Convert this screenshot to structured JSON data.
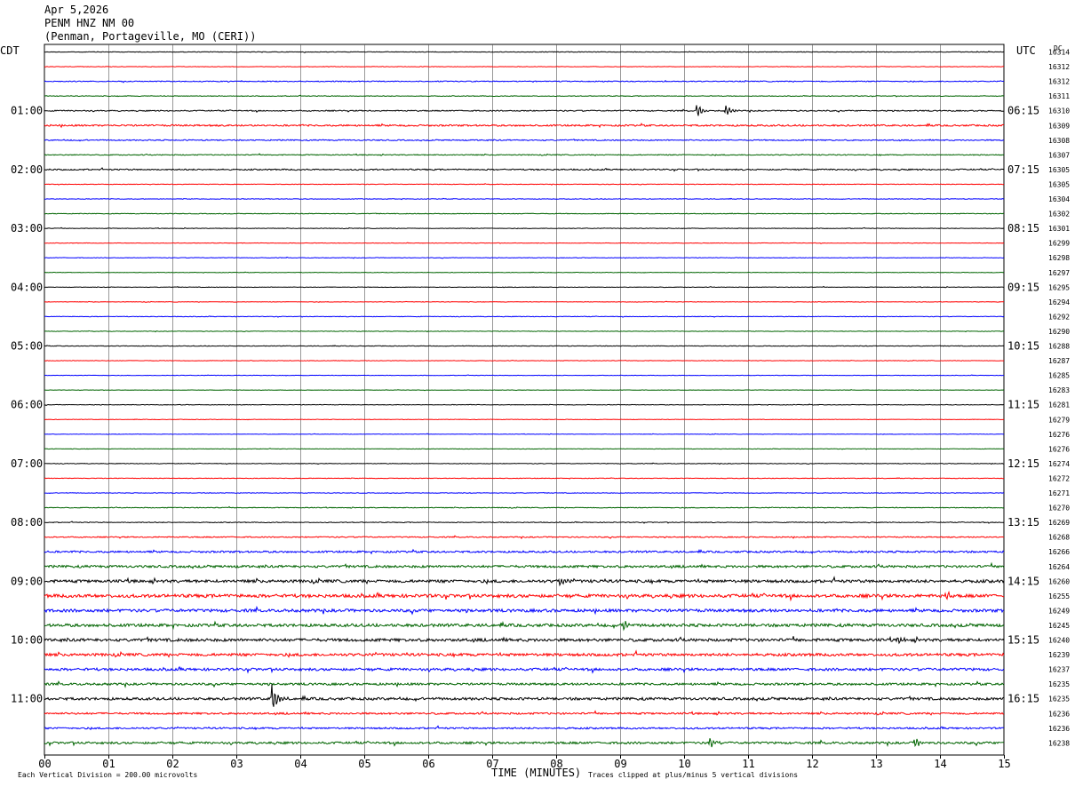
{
  "header": {
    "date": "Apr 5,2026",
    "station": "PENM HNZ NM 00",
    "location": "(Penman, Portageville, MO (CERI))"
  },
  "chart_data": {
    "type": "line",
    "title": "",
    "left_timezone": "CDT",
    "right_timezone": "UTC",
    "dc_label": "DC",
    "xlabel": "TIME (MINUTES)",
    "xlim": [
      0,
      15
    ],
    "x_ticks": [
      "00",
      "01",
      "02",
      "03",
      "04",
      "05",
      "06",
      "07",
      "08",
      "09",
      "10",
      "11",
      "12",
      "13",
      "14",
      "15"
    ],
    "trace_colors": [
      "#000000",
      "#ff0000",
      "#0000ff",
      "#006400"
    ],
    "left_hour_labels": [
      {
        "row": 4,
        "label": "01:00"
      },
      {
        "row": 8,
        "label": "02:00"
      },
      {
        "row": 12,
        "label": "03:00"
      },
      {
        "row": 16,
        "label": "04:00"
      },
      {
        "row": 20,
        "label": "05:00"
      },
      {
        "row": 24,
        "label": "06:00"
      },
      {
        "row": 28,
        "label": "07:00"
      },
      {
        "row": 32,
        "label": "08:00"
      },
      {
        "row": 36,
        "label": "09:00"
      },
      {
        "row": 40,
        "label": "10:00"
      },
      {
        "row": 44,
        "label": "11:00"
      }
    ],
    "right_hour_labels": [
      {
        "row": 4,
        "label": "06:15"
      },
      {
        "row": 8,
        "label": "07:15"
      },
      {
        "row": 12,
        "label": "08:15"
      },
      {
        "row": 16,
        "label": "09:15"
      },
      {
        "row": 20,
        "label": "10:15"
      },
      {
        "row": 24,
        "label": "11:15"
      },
      {
        "row": 28,
        "label": "12:15"
      },
      {
        "row": 32,
        "label": "13:15"
      },
      {
        "row": 36,
        "label": "14:15"
      },
      {
        "row": 40,
        "label": "15:15"
      },
      {
        "row": 44,
        "label": "16:15"
      }
    ],
    "dc_offsets": [
      "16314",
      "16312",
      "16312",
      "16311",
      "16310",
      "16309",
      "16308",
      "16307",
      "16305",
      "16305",
      "16304",
      "16302",
      "16301",
      "16299",
      "16298",
      "16297",
      "16295",
      "16294",
      "16292",
      "16290",
      "16288",
      "16287",
      "16285",
      "16283",
      "16281",
      "16279",
      "16276",
      "16276",
      "16274",
      "16272",
      "16271",
      "16270",
      "16269",
      "16268",
      "16266",
      "16264",
      "16260",
      "16255",
      "16249",
      "16245",
      "16240",
      "16239",
      "16237",
      "16235",
      "16235",
      "16236",
      "16236",
      "16238"
    ],
    "trace_noise": [
      0.3,
      0.25,
      0.5,
      0.35,
      0.6,
      0.9,
      0.6,
      0.5,
      0.7,
      0.3,
      0.3,
      0.35,
      0.3,
      0.25,
      0.3,
      0.25,
      0.3,
      0.25,
      0.3,
      0.25,
      0.3,
      0.25,
      0.25,
      0.2,
      0.3,
      0.25,
      0.25,
      0.25,
      0.3,
      0.3,
      0.3,
      0.4,
      0.4,
      0.6,
      1.0,
      1.3,
      1.6,
      1.8,
      1.6,
      1.6,
      1.6,
      1.5,
      1.4,
      1.2,
      1.4,
      1.0,
      0.9,
      1.2
    ],
    "events": [
      {
        "row": 4,
        "minute": 10.2,
        "amplitude": 9
      },
      {
        "row": 4,
        "minute": 10.65,
        "amplitude": 7
      },
      {
        "row": 36,
        "minute": 8.05,
        "amplitude": 5
      },
      {
        "row": 37,
        "minute": 14.1,
        "amplitude": 6
      },
      {
        "row": 39,
        "minute": 9.05,
        "amplitude": 7
      },
      {
        "row": 40,
        "minute": 13.35,
        "amplitude": 6
      },
      {
        "row": 44,
        "minute": 3.55,
        "amplitude": 18
      },
      {
        "row": 47,
        "minute": 10.4,
        "amplitude": 6
      },
      {
        "row": 47,
        "minute": 13.6,
        "amplitude": 6
      }
    ],
    "grid": true
  },
  "footer": {
    "scale_note": "Each Vertical Division =  200.00 microvolts",
    "clip_note": "Traces clipped at plus/minus 5 vertical divisions"
  }
}
